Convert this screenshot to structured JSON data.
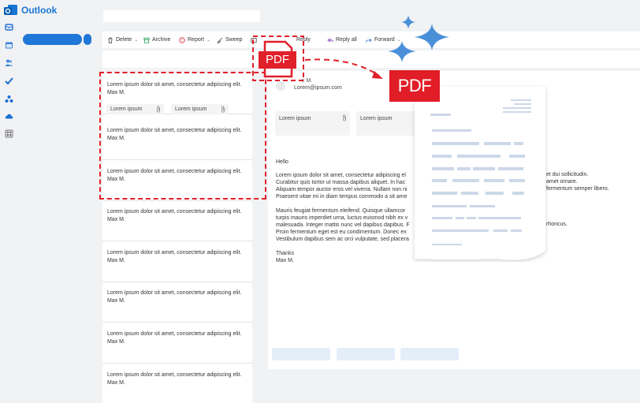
{
  "app": {
    "title": "Outlook"
  },
  "toolbar": {
    "delete": "Delete",
    "archive": "Archive",
    "report": "Report",
    "sweep": "Sweep",
    "reply": "Reply",
    "reply_all": "Reply all",
    "forward": "Forward"
  },
  "messages": [
    {
      "preview": "Lorem ipsum dolor sit amet, consectetur adipiscing elit.",
      "sender": "Max M."
    },
    {
      "preview": "Lorem ipsum dolor sit amet, consectetur adipiscing elit.",
      "sender": "Max M."
    },
    {
      "preview": "Lorem ipsum dolor sit amet, consectetur adipiscing elit.",
      "sender": "Max M."
    },
    {
      "preview": "Lorem ipsum dolor sit amet, consectetur adipiscing elit.",
      "sender": "Max M."
    },
    {
      "preview": "Lorem ipsum dolor sit amet, consectetur adipiscing elit.",
      "sender": "Max M."
    },
    {
      "preview": "Lorem ipsum dolor sit amet, consectetur adipiscing elit.",
      "sender": "Max M."
    },
    {
      "preview": "Lorem ipsum dolor sit amet, consectetur adipiscing elit.",
      "sender": "Max M."
    },
    {
      "preview": "Lorem ipsum dolor sit amet, consectetur adipiscing elit.",
      "sender": "Max M."
    }
  ],
  "message_chips": [
    "Lorem ipsum",
    "Lorem ipsum"
  ],
  "reading": {
    "sender_name": "x M.",
    "sender_email": "Lorem@ipsum.com",
    "attachments": [
      "Lorem ipsum",
      "Lorem ipsum"
    ],
    "greeting": "Hello",
    "para1": [
      "Lorem ipsum dolor sit amet, consectetur adipiscing el",
      "Curabitur quis tortor ut massa dapibus aliquet. In hac",
      "Aliquam tempor auctor eros vel viverra. Nullam non ni",
      "Praesent vitae mi in diam tempus commodo a sit ame"
    ],
    "para1_tails": [
      "et dui sollicitudin.",
      "amet ornare.",
      "fermentum semper libero."
    ],
    "para2": [
      "Mauris feugiat fermentum eleifend. Quisque ullamcor",
      "turpis mauris imperdiet urna, luctus euismod nibh ex v",
      "malesuada. Integer mattis nunc vel dapibus dapibus. F",
      "Proin fermentum eget est eu condimentum. Donec ex",
      "Vestibulum dapibus sem ac orci vulputate, sed placera"
    ],
    "para2_tail": "rhoncus.",
    "signoff": "Thanks",
    "signature": "Max M."
  },
  "pdf": {
    "drag_label": "PDF",
    "badge_label": "PDF"
  },
  "colors": {
    "accent": "#1f77d8",
    "pdf_red": "#e11d27",
    "sparkle": "#4a90d9"
  }
}
